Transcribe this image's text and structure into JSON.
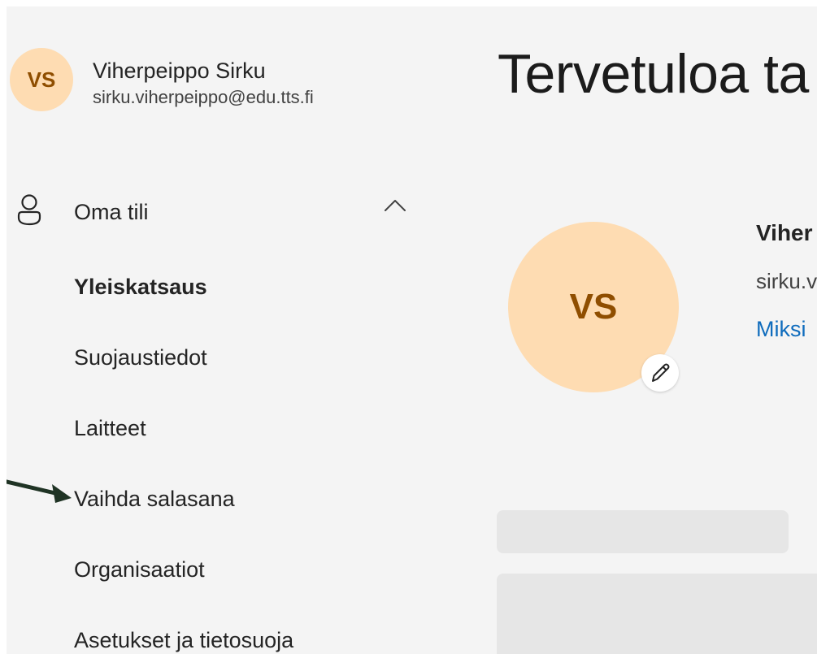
{
  "user": {
    "initials": "VS",
    "name": "Viherpeippo Sirku",
    "email": "sirku.viherpeippo@edu.tts.fi",
    "avatar_bg": "#fedcb2",
    "avatar_fg": "#8f4e00"
  },
  "sidebar": {
    "section": {
      "label": "Oma tili",
      "icon": "person-icon",
      "toggle_icon": "chevron-up-icon",
      "expanded": true
    },
    "items": [
      {
        "label": "Yleiskatsaus",
        "active": true
      },
      {
        "label": "Suojaustiedot",
        "active": false
      },
      {
        "label": "Laitteet",
        "active": false
      },
      {
        "label": "Vaihda salasana",
        "active": false,
        "annotated_with_arrow": true
      },
      {
        "label": "Organisaatiot",
        "active": false
      },
      {
        "label": "Asetukset ja tietosuoja",
        "active": false
      }
    ]
  },
  "main": {
    "welcome_title": "Tervetuloa ta",
    "profile": {
      "initials": "VS",
      "name_partial": "Viher",
      "email_partial": "sirku.v",
      "link_partial": "Miksi",
      "edit_icon": "pencil-icon"
    }
  },
  "colors": {
    "page_bg": "#f4f4f4",
    "link": "#0f6cbd",
    "arrow": "#1f3324",
    "skeleton": "#e6e6e6"
  }
}
